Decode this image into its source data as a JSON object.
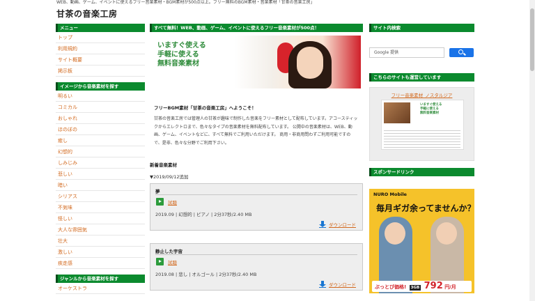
{
  "header": {
    "tagline": "WEB、動画、ゲーム、イベントに使えるフリー音楽素材・BGM素材が500点以上。フリー無料のBGM素材・音楽素材「甘茶の音楽工房」",
    "title": "甘茶の音楽工房"
  },
  "left": {
    "menu_head": "メニュー",
    "menu": [
      "トップ",
      "利用規約",
      "サイト概要",
      "掲示板"
    ],
    "image_head": "イメージから音楽素材を探す",
    "images": [
      "明るい",
      "コミカル",
      "おしゃれ",
      "ほのぼの",
      "癒し",
      "幻想的",
      "しみじみ",
      "悲しい",
      "暗い",
      "シリアス",
      "不気味",
      "怪しい",
      "大人な雰囲気",
      "壮大",
      "激しい",
      "疾走感"
    ],
    "genre_head": "ジャンルから音楽素材を探す",
    "genres": [
      "オーケストラ"
    ]
  },
  "main": {
    "banner_head": "すべて無料！WEB、動画、ゲーム、イベントに使えるフリー音楽素材が500点！",
    "banner_text": "いますぐ使える\n手軽に使える\n無料音楽素材",
    "welcome": "フリーBGM素材「甘茶の音楽工房」へようこそ！",
    "intro": "甘茶の音楽工房では管理人の甘茶が趣味で制作した音楽をフリー素材として配布しています。アコースティックからエレクトロまで、色々なタイプの音楽素材を無料配布しています。 公開中の音楽素材は、WEB、動画、ゲーム、イベントなどに、すべて無料でご利用いただけます。 商用・非商用問わずご利用可能ですので、是非、色々な分野でご利用下さい。",
    "new_head": "新着音楽素材",
    "added": "▼2019/09/12追加",
    "tracks": [
      {
        "title": "夢",
        "play": "試聴",
        "meta": "2019.09 | 幻想的 | ピアノ | 2分37秒/2.40 MB",
        "download": "ダウンロード"
      },
      {
        "title": "静止した宇宙",
        "play": "試聴",
        "meta": "2019.08 | 悲し | オルゴール | 2分37秒/2.40 MB",
        "download": "ダウンロード"
      }
    ]
  },
  "right": {
    "search_head": "サイト内検索",
    "search_placeholder": "Google 提供",
    "sister_head": "こちらのサイトも運営しています",
    "sister_link": "フリー音楽素材_ノスタルジア",
    "sister_thumb_text": "いますぐ使える\n手軽に使える\n無料音楽素材",
    "sponsor_head": "スポンサードリンク",
    "ad": {
      "brand": "NURO Mobile",
      "copy": "毎月ギガ余ってませんか？",
      "price_lead": "ぶっとび価格!",
      "price_tag": "3GB",
      "price": "792",
      "price_unit": "円/月"
    }
  }
}
